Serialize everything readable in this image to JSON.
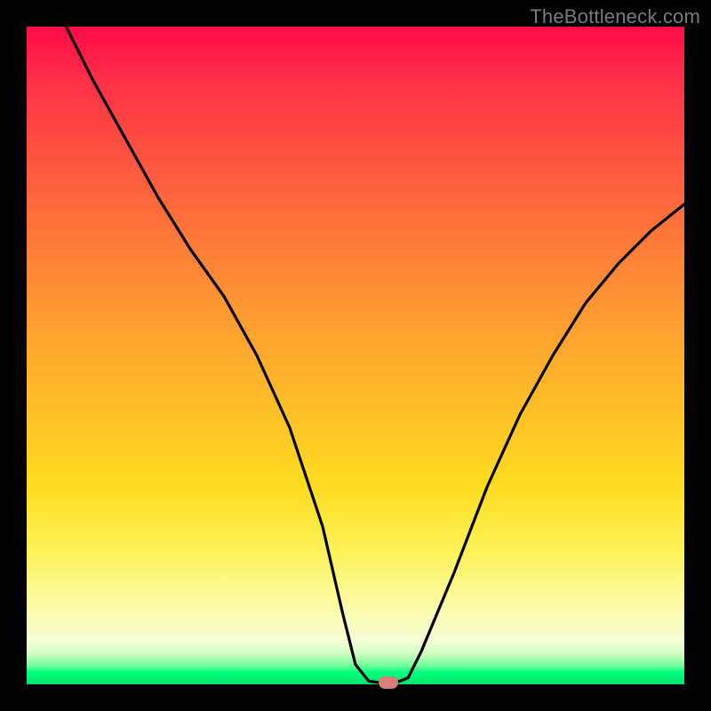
{
  "watermark": "TheBottleneck.com",
  "chart_data": {
    "type": "line",
    "title": "",
    "xlabel": "",
    "ylabel": "",
    "xlim": [
      0,
      100
    ],
    "ylim": [
      0,
      100
    ],
    "grid": false,
    "legend": false,
    "series": [
      {
        "name": "curve",
        "x": [
          6,
          10,
          15,
          20,
          25,
          30,
          35,
          40,
          45,
          48,
          50,
          52,
          54,
          56,
          58,
          60,
          65,
          70,
          75,
          80,
          85,
          90,
          95,
          100
        ],
        "y": [
          100,
          92,
          83,
          74,
          66,
          59,
          50,
          39,
          24,
          11,
          3,
          0.5,
          0.2,
          0.2,
          1,
          5,
          17,
          30,
          41,
          50,
          58,
          64,
          69,
          73
        ]
      }
    ],
    "marker": {
      "x": 55,
      "y": 0.3
    },
    "background_gradient": {
      "top": "#ff0a4a",
      "mid_upper": "#ff7e38",
      "mid": "#ffdc20",
      "mid_lower": "#fbfcaf",
      "bottom": "#00e56e"
    }
  }
}
